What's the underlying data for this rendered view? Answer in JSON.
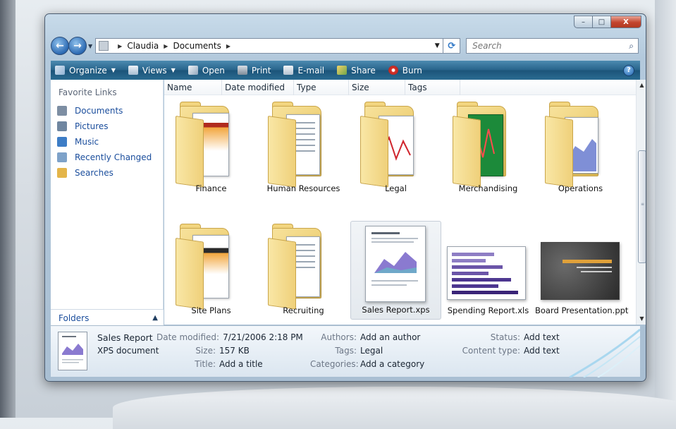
{
  "window": {
    "controls": {
      "minimize": "–",
      "maximize": "□",
      "close": "X"
    }
  },
  "address_bar": {
    "back_glyph": "←",
    "forward_glyph": "→",
    "crumbs": [
      "Claudia",
      "Documents"
    ],
    "refresh_glyph": "⟳"
  },
  "search": {
    "placeholder": "Search",
    "icon_glyph": "⌕"
  },
  "toolbar": {
    "organize": "Organize",
    "views": "Views",
    "open": "Open",
    "print": "Print",
    "email": "E-mail",
    "share": "Share",
    "burn": "Burn",
    "help": "?"
  },
  "nav_pane": {
    "heading": "Favorite Links",
    "links": [
      {
        "label": "Documents",
        "icon": "documents-icon",
        "color": "#7d8ea3"
      },
      {
        "label": "Pictures",
        "icon": "pictures-icon",
        "color": "#6f86a0"
      },
      {
        "label": "Music",
        "icon": "music-icon",
        "color": "#3d7dc6"
      },
      {
        "label": "Recently Changed",
        "icon": "recently-changed-icon",
        "color": "#7ea2c9"
      },
      {
        "label": "Searches",
        "icon": "searches-icon",
        "color": "#e4b54a"
      }
    ],
    "folders_label": "Folders"
  },
  "columns": [
    "Name",
    "Date modified",
    "Type",
    "Size",
    "Tags"
  ],
  "items": [
    {
      "label": "Finance",
      "kind": "folder",
      "selected": false
    },
    {
      "label": "Human Resources",
      "kind": "folder",
      "selected": false
    },
    {
      "label": "Legal",
      "kind": "folder",
      "selected": false
    },
    {
      "label": "Merchandising",
      "kind": "folder",
      "selected": false
    },
    {
      "label": "Operations",
      "kind": "folder",
      "selected": false
    },
    {
      "label": "Site Plans",
      "kind": "folder",
      "selected": false
    },
    {
      "label": "Recruiting",
      "kind": "folder",
      "selected": false
    },
    {
      "label": "Sales Report.xps",
      "kind": "xps-document",
      "selected": true
    },
    {
      "label": "Spending Report.xls",
      "kind": "spreadsheet",
      "selected": false
    },
    {
      "label": "Board Presentation.ppt",
      "kind": "presentation",
      "selected": false
    }
  ],
  "details": {
    "name": "Sales Report",
    "type": "XPS document",
    "fields": [
      {
        "key": "Date modified:",
        "value": "7/21/2006 2:18 PM"
      },
      {
        "key": "Size:",
        "value": "157 KB"
      },
      {
        "key": "Title:",
        "value": "Add a title"
      },
      {
        "key": "Authors:",
        "value": "Add an author"
      },
      {
        "key": "Tags:",
        "value": "Legal"
      },
      {
        "key": "Categories:",
        "value": "Add a category"
      },
      {
        "key": "Status:",
        "value": "Add text"
      },
      {
        "key": "Content type:",
        "value": "Add text"
      }
    ]
  },
  "colors": {
    "toolbar": "#27638a",
    "link": "#1a4d9c",
    "folder": "#efd07a",
    "close_button": "#c3452e"
  }
}
